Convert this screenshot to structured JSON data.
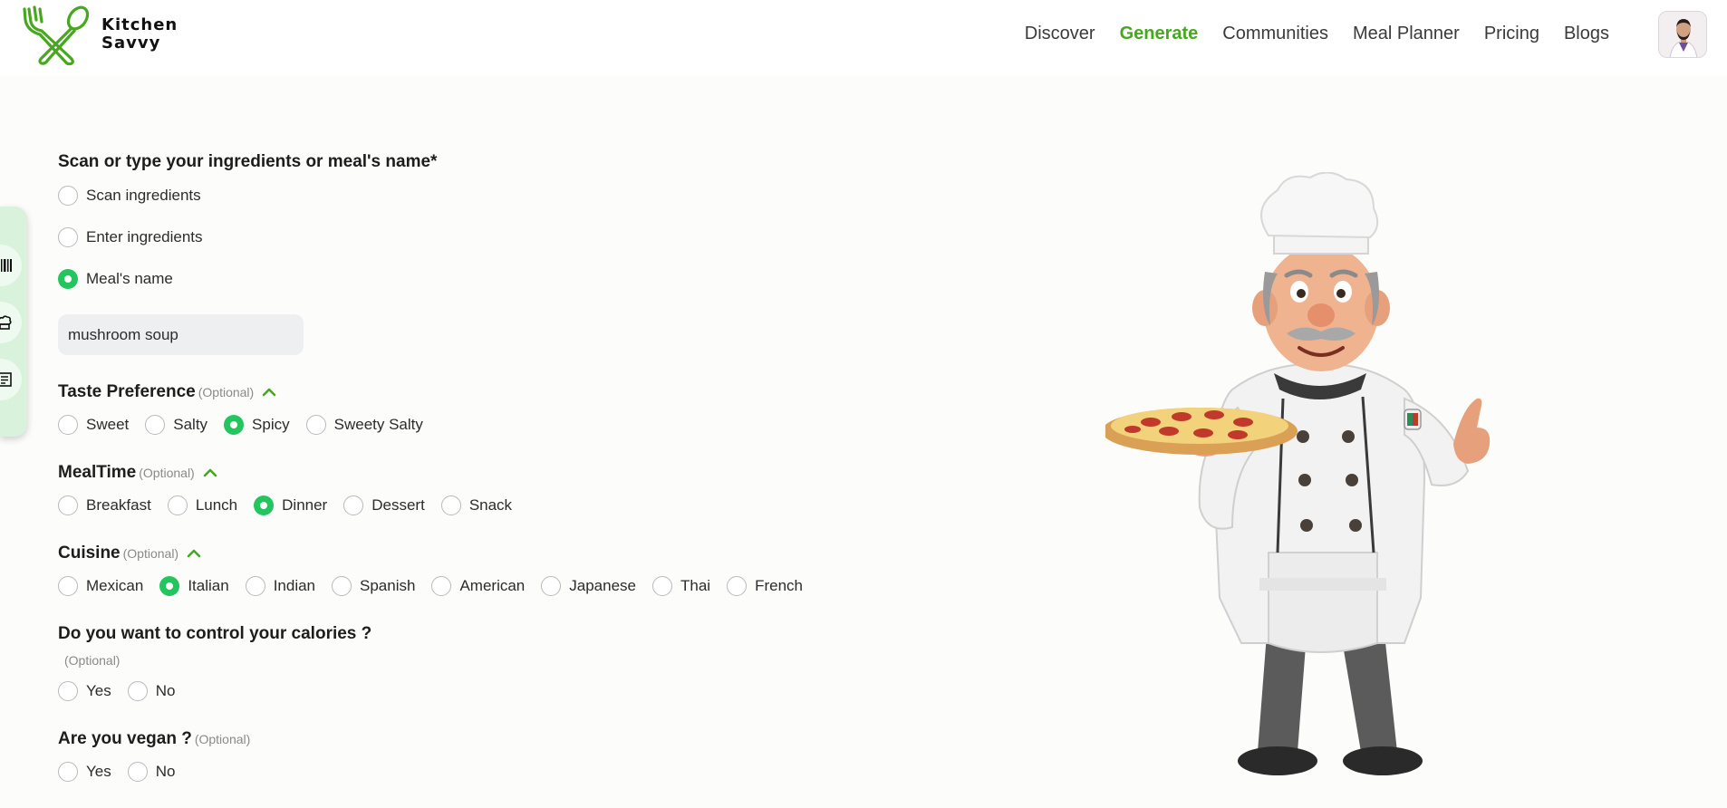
{
  "brand": {
    "name_line1": "Kitchen",
    "name_line2": "Savvy",
    "accent_color": "#47a820"
  },
  "nav": {
    "items": [
      {
        "label": "Discover",
        "active": false
      },
      {
        "label": "Generate",
        "active": true
      },
      {
        "label": "Communities",
        "active": false
      },
      {
        "label": "Meal Planner",
        "active": false
      },
      {
        "label": "Pricing",
        "active": false
      },
      {
        "label": "Blogs",
        "active": false
      }
    ]
  },
  "side_rail": {
    "icons": [
      "barcode-icon",
      "chef-hat-icon",
      "recipe-icon"
    ]
  },
  "form": {
    "ingredients": {
      "title": "Scan or type your ingredients or meal's name*",
      "options": [
        {
          "label": "Scan ingredients",
          "checked": false
        },
        {
          "label": "Enter ingredients",
          "checked": false
        },
        {
          "label": "Meal's name",
          "checked": true
        }
      ],
      "input_value": "mushroom soup"
    },
    "taste": {
      "title": "Taste Preference",
      "optional": "(Optional)",
      "options": [
        {
          "label": "Sweet",
          "checked": false
        },
        {
          "label": "Salty",
          "checked": false
        },
        {
          "label": "Spicy",
          "checked": true
        },
        {
          "label": "Sweety Salty",
          "checked": false
        }
      ]
    },
    "mealtime": {
      "title": "MealTime",
      "optional": "(Optional)",
      "options": [
        {
          "label": "Breakfast",
          "checked": false
        },
        {
          "label": "Lunch",
          "checked": false
        },
        {
          "label": "Dinner",
          "checked": true
        },
        {
          "label": "Dessert",
          "checked": false
        },
        {
          "label": "Snack",
          "checked": false
        }
      ]
    },
    "cuisine": {
      "title": "Cuisine",
      "optional": "(Optional)",
      "options": [
        {
          "label": "Mexican",
          "checked": false
        },
        {
          "label": "Italian",
          "checked": true
        },
        {
          "label": "Indian",
          "checked": false
        },
        {
          "label": "Spanish",
          "checked": false
        },
        {
          "label": "American",
          "checked": false
        },
        {
          "label": "Japanese",
          "checked": false
        },
        {
          "label": "Thai",
          "checked": false
        },
        {
          "label": "French",
          "checked": false
        }
      ]
    },
    "calories": {
      "title": "Do you want to control your calories ?",
      "optional": "(Optional)",
      "options": [
        {
          "label": "Yes",
          "checked": false
        },
        {
          "label": "No",
          "checked": false
        }
      ]
    },
    "vegan": {
      "title": "Are you vegan ?",
      "optional": "(Optional)",
      "options": [
        {
          "label": "Yes",
          "checked": false
        },
        {
          "label": "No",
          "checked": false
        }
      ]
    }
  },
  "colors": {
    "radio_checked": "#22c55e",
    "side_rail": "#d8f2dc",
    "input_bg": "#eeeff1"
  }
}
